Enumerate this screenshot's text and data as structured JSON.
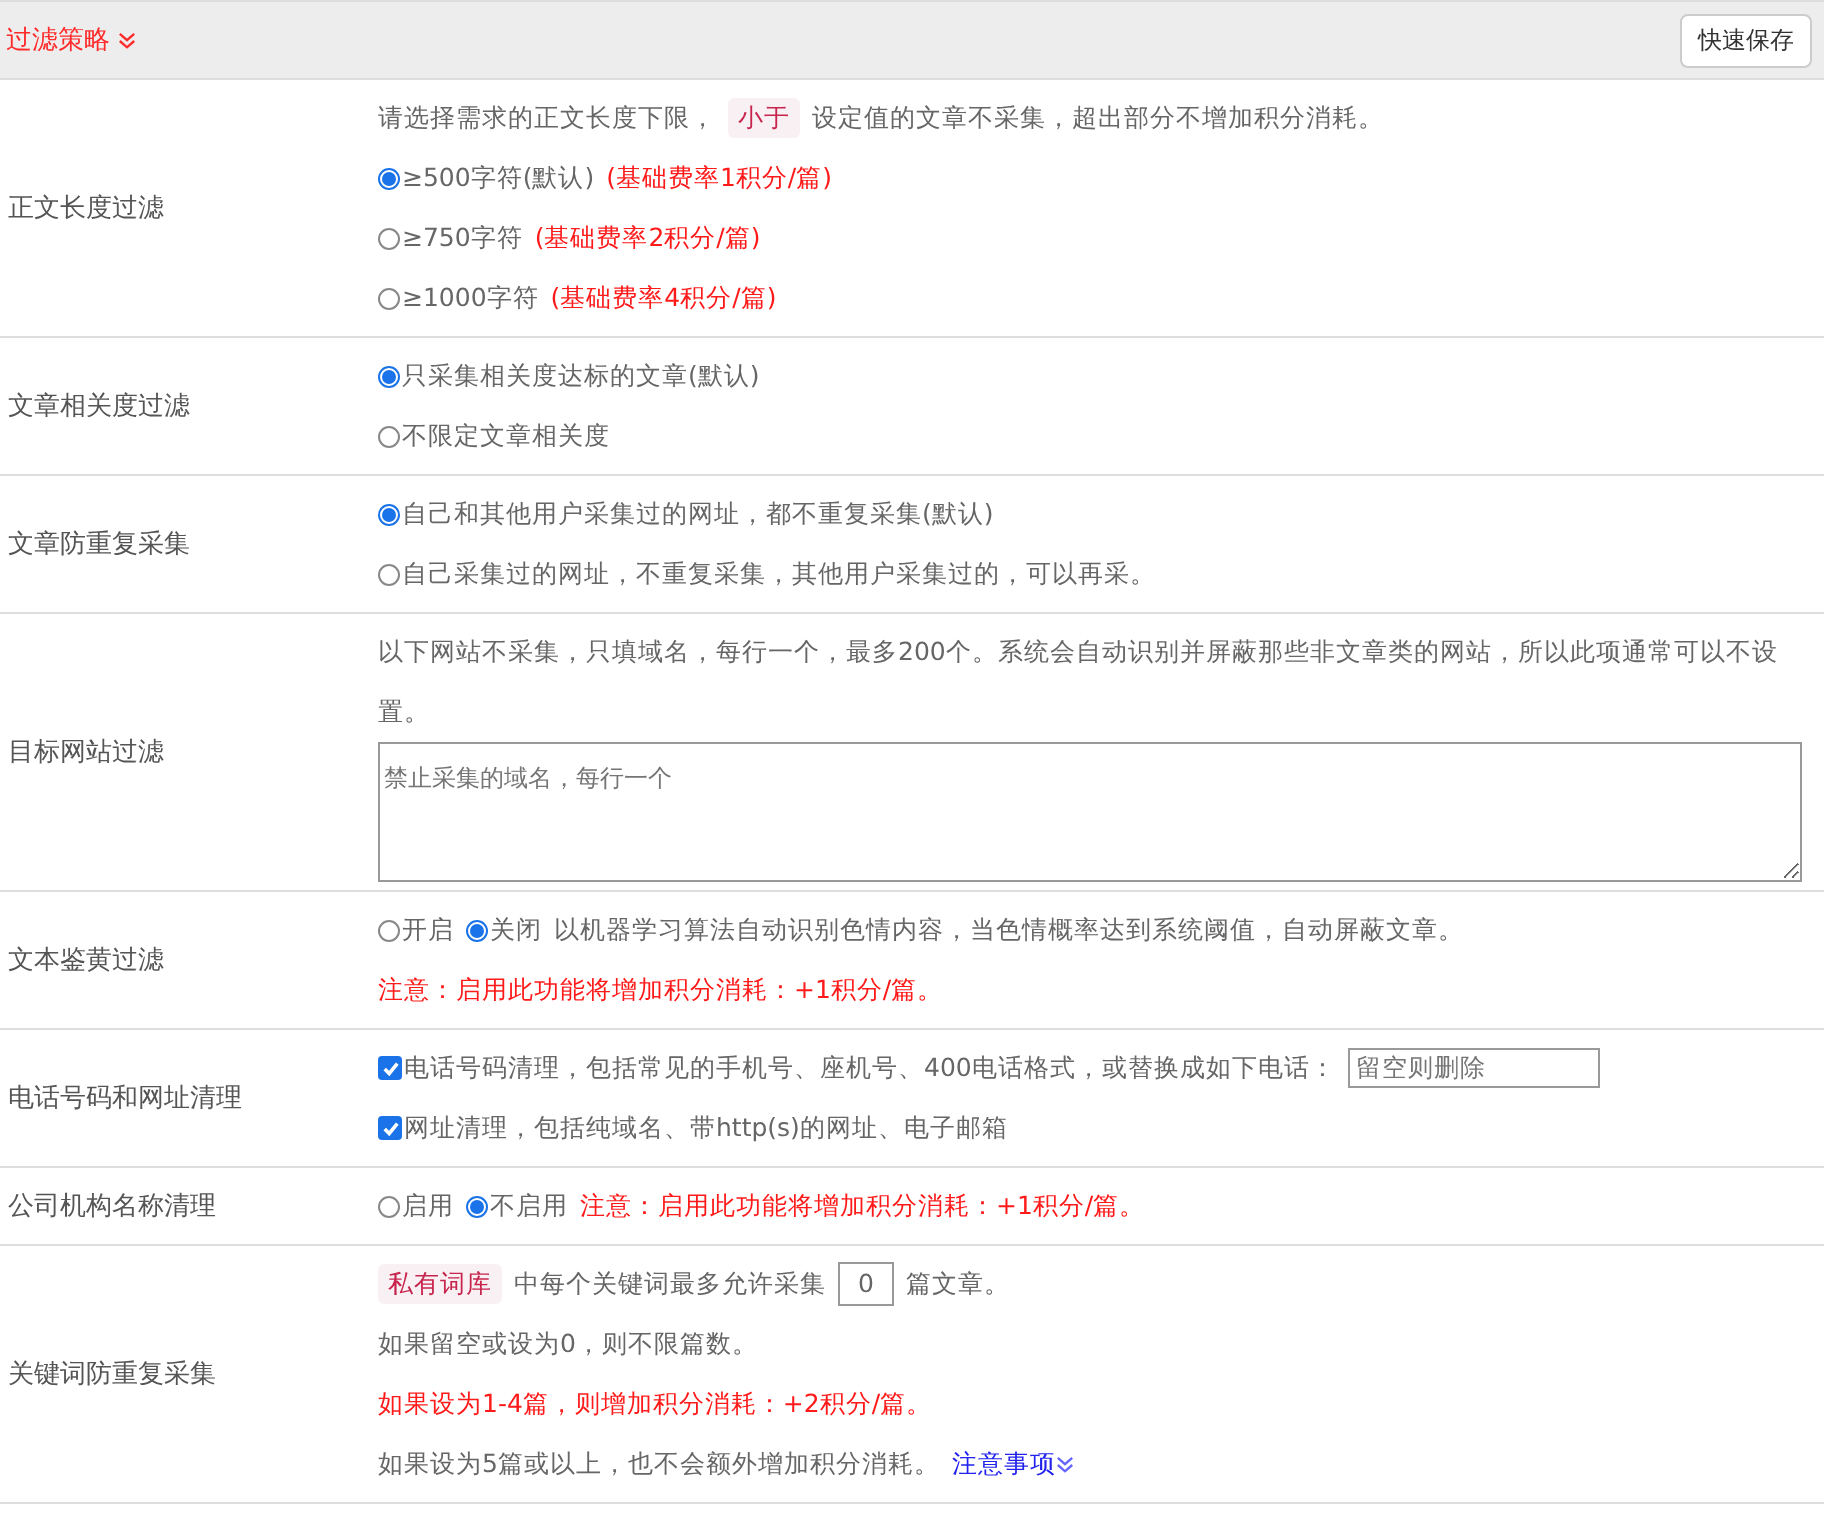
{
  "header": {
    "title": "过滤策略",
    "button": "快速保存"
  },
  "rows": [
    {
      "label": "正文长度过滤",
      "lines": [
        [
          {
            "kind": "text",
            "text": "请选择需求的正文长度下限，"
          },
          {
            "kind": "tag",
            "text": "小于"
          },
          {
            "kind": "text",
            "text": "设定值的文章不采集，超出部分不增加积分消耗。"
          }
        ],
        [
          {
            "kind": "radio",
            "label": "≥500字符(默认)",
            "selected": true
          },
          {
            "kind": "note",
            "text": "(基础费率1积分/篇)"
          }
        ],
        [
          {
            "kind": "radio",
            "label": "≥750字符",
            "selected": false
          },
          {
            "kind": "note",
            "text": "(基础费率2积分/篇)"
          }
        ],
        [
          {
            "kind": "radio",
            "label": "≥1000字符",
            "selected": false
          },
          {
            "kind": "note",
            "text": "(基础费率4积分/篇)"
          }
        ]
      ]
    },
    {
      "label": "文章相关度过滤",
      "lines": [
        [
          {
            "kind": "radio",
            "label": "只采集相关度达标的文章(默认)",
            "selected": true
          }
        ],
        [
          {
            "kind": "radio",
            "label": "不限定文章相关度",
            "selected": false
          }
        ]
      ]
    },
    {
      "label": "文章防重复采集",
      "lines": [
        [
          {
            "kind": "radio",
            "label": "自己和其他用户采集过的网址，都不重复采集(默认)",
            "selected": true
          }
        ],
        [
          {
            "kind": "radio",
            "label": "自己采集过的网址，不重复采集，其他用户采集过的，可以再采。",
            "selected": false
          }
        ]
      ]
    },
    {
      "label": "目标网站过滤",
      "lines": [
        [
          {
            "kind": "text",
            "text": "以下网站不采集，只填域名，每行一个，最多200个。系统会自动识别并屏蔽那些非文章类的网站，所以此项通常可以不设置。"
          }
        ],
        [
          {
            "kind": "textarea",
            "placeholder": "禁止采集的域名，每行一个"
          }
        ]
      ]
    },
    {
      "label": "文本鉴黄过滤",
      "lines": [
        [
          {
            "kind": "radio",
            "label": "开启",
            "selected": false
          },
          {
            "kind": "radio",
            "label": "关闭",
            "selected": true
          },
          {
            "kind": "text",
            "text": "以机器学习算法自动识别色情内容，当色情概率达到系统阈值，自动屏蔽文章。"
          }
        ],
        [
          {
            "kind": "note",
            "text": "注意：启用此功能将增加积分消耗：+1积分/篇。"
          }
        ]
      ]
    },
    {
      "label": "电话号码和网址清理",
      "lines": [
        [
          {
            "kind": "checkbox",
            "label": "电话号码清理，包括常见的手机号、座机号、400电话格式，或替换成如下电话：",
            "checked": true
          },
          {
            "kind": "input",
            "placeholder": "留空则删除"
          }
        ],
        [
          {
            "kind": "checkbox",
            "label": "网址清理，包括纯域名、带http(s)的网址、电子邮箱",
            "checked": true
          }
        ]
      ]
    },
    {
      "label": "公司机构名称清理",
      "lines": [
        [
          {
            "kind": "radio",
            "label": "启用",
            "selected": false
          },
          {
            "kind": "radio",
            "label": "不启用",
            "selected": true
          },
          {
            "kind": "note",
            "text": "注意：启用此功能将增加积分消耗：+1积分/篇。"
          }
        ]
      ]
    },
    {
      "label": "关键词防重复采集",
      "lines": [
        [
          {
            "kind": "tag",
            "text": "私有词库"
          },
          {
            "kind": "text",
            "text": "中每个关键词最多允许采集"
          },
          {
            "kind": "number",
            "value": "0"
          },
          {
            "kind": "text",
            "text": "篇文章。"
          }
        ],
        [
          {
            "kind": "text",
            "text": "如果留空或设为0，则不限篇数。"
          }
        ],
        [
          {
            "kind": "note",
            "text": "如果设为1-4篇，则增加积分消耗：+2积分/篇。"
          }
        ],
        [
          {
            "kind": "text",
            "text": "如果设为5篇或以上，也不会额外增加积分消耗。"
          },
          {
            "kind": "link",
            "text": "注意事项"
          }
        ]
      ]
    }
  ]
}
